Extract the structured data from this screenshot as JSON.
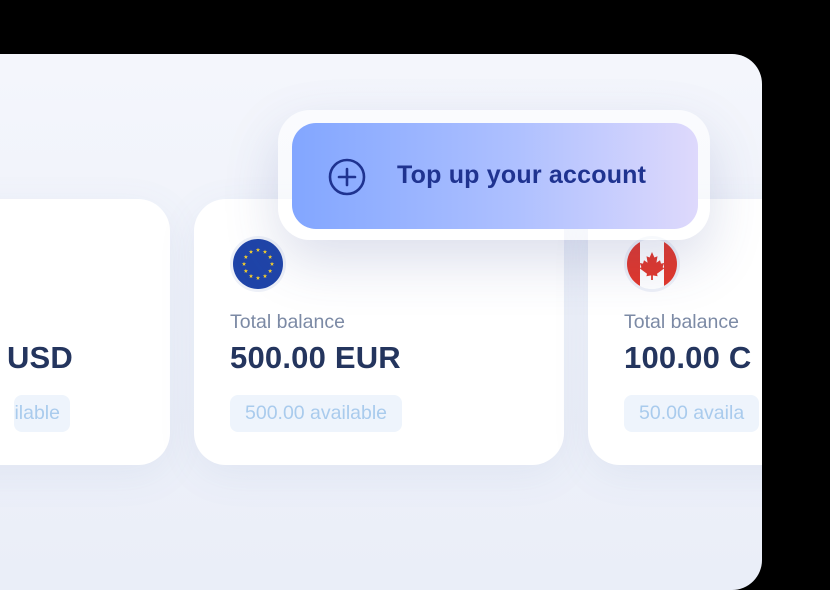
{
  "accounts": [
    {
      "currency": "USD",
      "amount": "USD",
      "available": "ilable",
      "flag_icon": "usa-flag-icon"
    },
    {
      "currency": "EUR",
      "total_label": "Total balance",
      "amount": "500.00 EUR",
      "available": "500.00 available",
      "flag_icon": "eu-flag-icon"
    },
    {
      "currency": "CAD",
      "total_label": "Total balance",
      "amount": "100.00 C",
      "available": "50.00 availa",
      "flag_icon": "canada-flag-icon"
    }
  ],
  "topup": {
    "label": "Top up your account",
    "icon": "plus-circle-icon"
  },
  "colors": {
    "amount_text": "#24355e",
    "label_text": "#7c8aa5",
    "available_bg": "#eef4fc",
    "available_text": "#a9cbed",
    "topup_text": "#1f3390",
    "topup_gradient_start": "#82a6ff",
    "topup_gradient_end": "#ded9fc"
  }
}
